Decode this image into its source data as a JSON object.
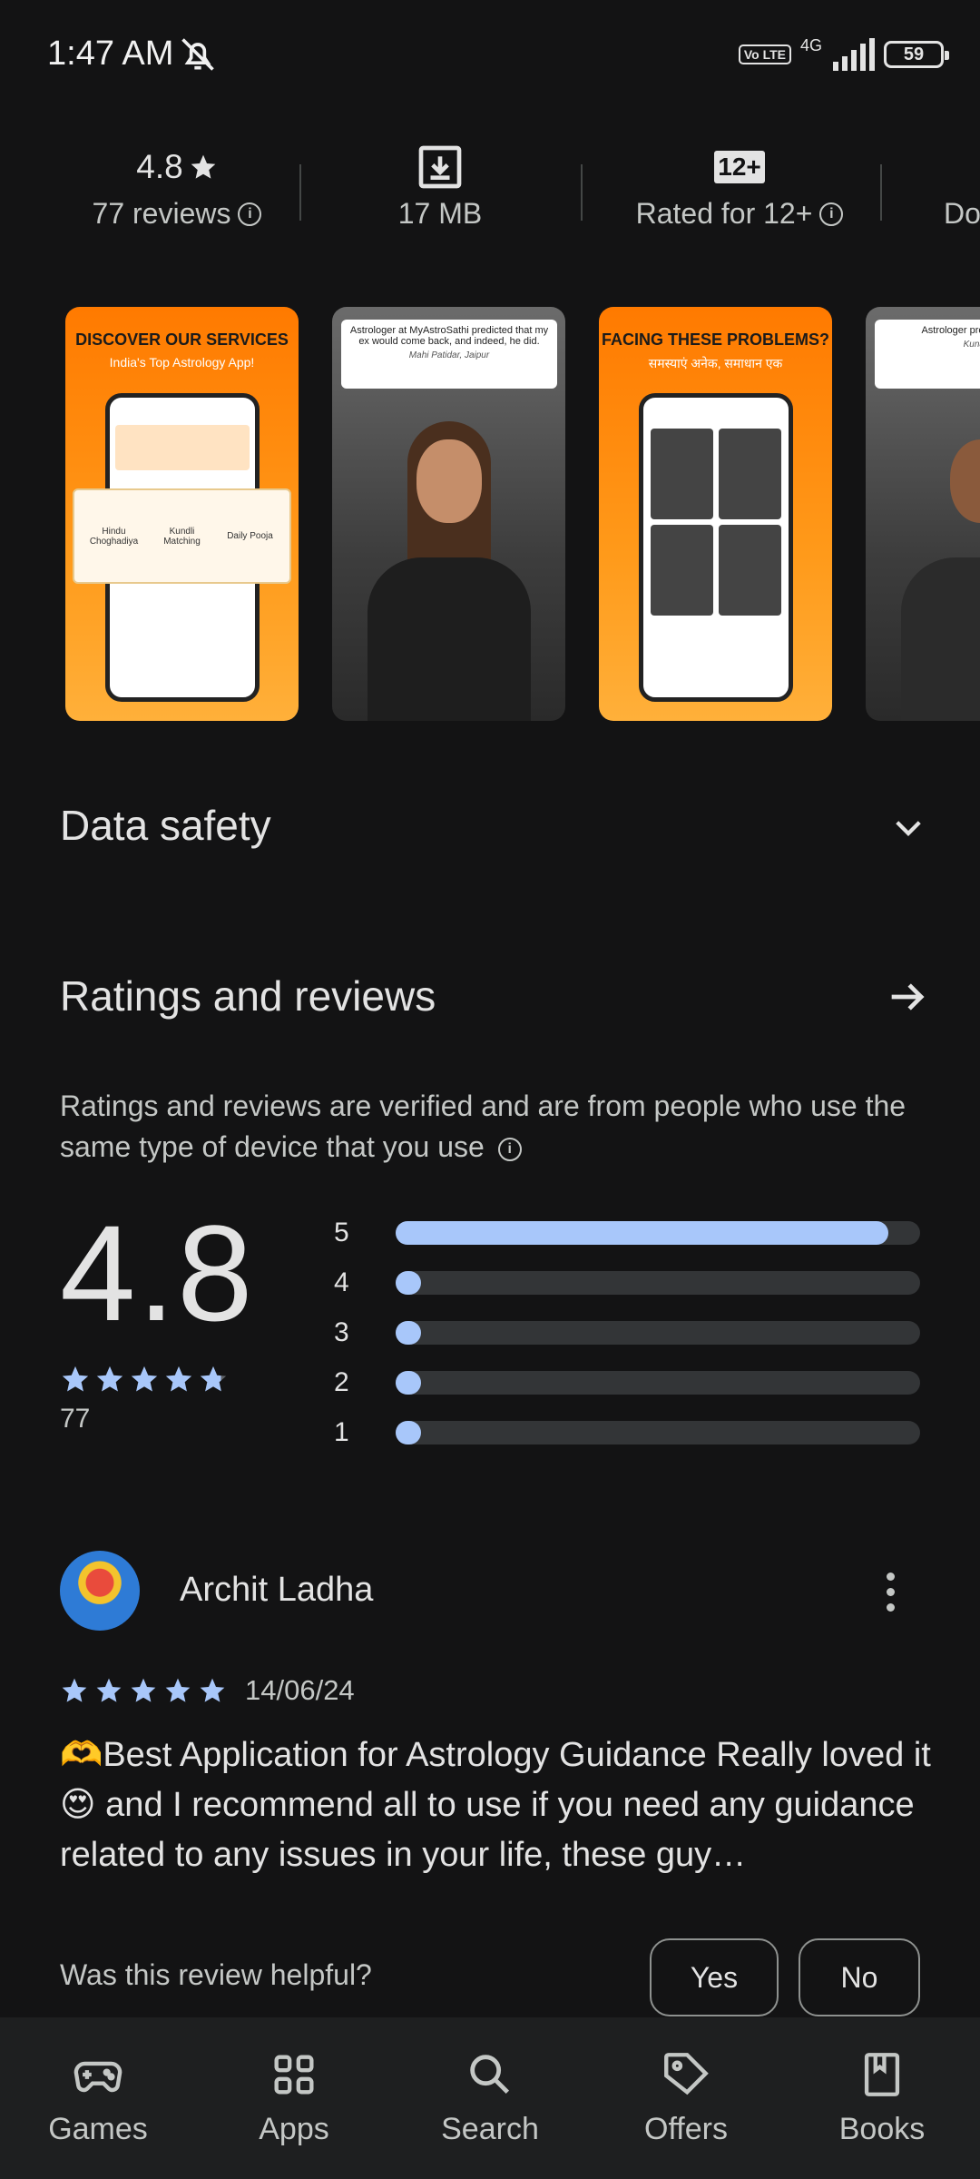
{
  "status_bar": {
    "time": "1:47 AM",
    "volte": "Vo LTE",
    "network": "4G",
    "battery": "59",
    "icons": [
      "bell-off-icon",
      "signal-icon",
      "battery-icon"
    ]
  },
  "stats": {
    "rating_value": "4.8",
    "reviews_label": "77 reviews",
    "size_label": "17 MB",
    "age_badge": "12+",
    "age_label": "Rated for 12+",
    "partial_label": "Do"
  },
  "screenshots": [
    {
      "title": "DISCOVER OUR SERVICES",
      "subtitle": "India's Top Astrology App!",
      "tiles": [
        "Hindu Choghadiya",
        "Kundli Matching",
        "Daily Pooja"
      ]
    },
    {
      "quote": "Astrologer at MyAstroSathi predicted that my ex would come back, and indeed, he did.",
      "author": "Mahi Patidar, Jaipur"
    },
    {
      "title": "FACING THESE PROBLEMS?",
      "subtitle": "समस्याएं अनेक, समाधान एक"
    },
    {
      "quote": "Astrologer pre get the Prom",
      "author": "Kunal Dix"
    }
  ],
  "data_safety": {
    "title": "Data safety"
  },
  "ratings": {
    "title": "Ratings and reviews",
    "verified_text": "Ratings and reviews are verified and are from people who use the same type of device that you use",
    "average": "4.8",
    "total": "77",
    "star_value": 4.8,
    "distribution": [
      {
        "label": "5",
        "fraction": 0.94
      },
      {
        "label": "4",
        "fraction": 0.02
      },
      {
        "label": "3",
        "fraction": 0.02
      },
      {
        "label": "2",
        "fraction": 0.02
      },
      {
        "label": "1",
        "fraction": 0.02
      }
    ]
  },
  "review": {
    "name": "Archit Ladha",
    "date": "14/06/24",
    "stars": 5,
    "body": "🫶Best Application for Astrology Guidance Really loved it😍 and I recommend all to use if you need any guidance related to any issues in your life, these guy…",
    "helpful_question": "Was this review helpful?",
    "yes_label": "Yes",
    "no_label": "No"
  },
  "bottom_nav": [
    {
      "label": "Games",
      "icon": "gamepad-icon"
    },
    {
      "label": "Apps",
      "icon": "apps-grid-icon"
    },
    {
      "label": "Search",
      "icon": "search-icon"
    },
    {
      "label": "Offers",
      "icon": "tag-icon"
    },
    {
      "label": "Books",
      "icon": "book-icon"
    }
  ],
  "colors": {
    "background": "#131314",
    "accent": "#a8c7fa",
    "track": "#333537",
    "text": "#e3e3e3",
    "muted": "#c4c7c5",
    "nav_background": "#1e1f20"
  }
}
